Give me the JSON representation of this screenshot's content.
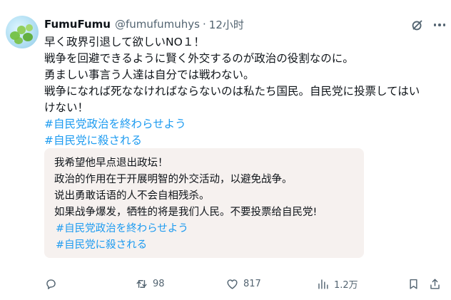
{
  "post": {
    "author_name": "FumuFumu",
    "author_handle": "@fumufumuhys",
    "separator": "·",
    "time": "12小时",
    "lines": [
      "早く政界引退して欲しいNO１！",
      "戦争を回避できるように賢く外交するのが政治の役割なのに。",
      "勇ましい事言う人達は自分では戦わない。",
      "戦争になれば死ななければならないのは私たち国民。自民党に投票してはい",
      "けない！"
    ],
    "hashtags": [
      "#自民党政治を終わらせよう",
      "#自民党に殺される"
    ]
  },
  "translation": {
    "lines": [
      "我希望他早点退出政坛！",
      "政治的作用在于开展明智的外交活动，以避免战争。",
      "说出勇敢话语的人不会自相残杀。",
      "如果战争爆发，牺牲的将是我们人民。不要投票给自民党!"
    ],
    "hashtags": [
      "#自民党政治を終わらせよう",
      "#自民党に殺される"
    ]
  },
  "actions": {
    "reply_count": "",
    "repost_count": "98",
    "like_count": "817",
    "views_count": "1.2万"
  },
  "icons": {
    "grok": "grok-icon",
    "more": "more-icon",
    "reply": "reply-icon",
    "repost": "repost-icon",
    "like": "like-icon",
    "views": "views-icon",
    "bookmark": "bookmark-icon",
    "share": "share-icon"
  },
  "colors": {
    "hashtag": "#1d9bf0",
    "text": "#0f1419",
    "secondary": "#536471",
    "card_background": "#f6f1ef"
  }
}
